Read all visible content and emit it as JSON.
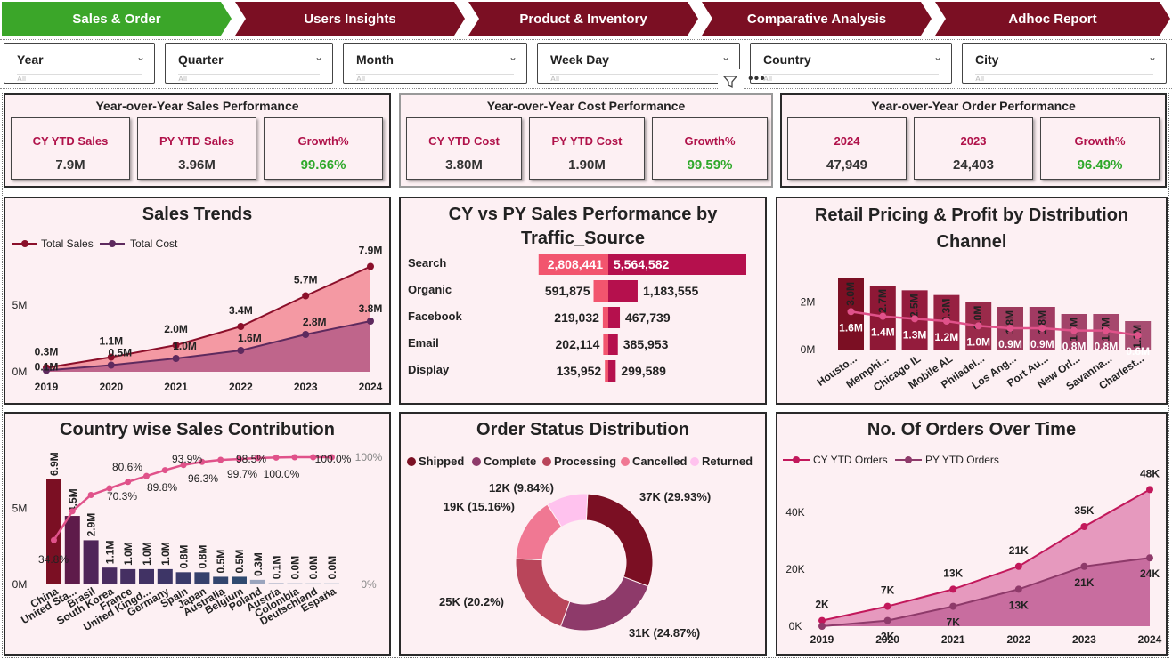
{
  "tabs": [
    {
      "label": "Sales & Order",
      "active": true
    },
    {
      "label": "Users Insights",
      "active": false
    },
    {
      "label": "Product & Inventory",
      "active": false
    },
    {
      "label": "Comparative Analysis",
      "active": false
    },
    {
      "label": "Adhoc Report",
      "active": false
    }
  ],
  "filters": [
    {
      "label": "Year",
      "value": "All"
    },
    {
      "label": "Quarter",
      "value": "All"
    },
    {
      "label": "Month",
      "value": "All"
    },
    {
      "label": "Week Day",
      "value": "All"
    },
    {
      "label": "Country",
      "value": "All"
    },
    {
      "label": "City",
      "value": "All"
    }
  ],
  "colors": {
    "accent": "#7b0f23",
    "active_tab": "#3ba629",
    "panel_bg": "#fdf0f3",
    "growth_green": "#2ea82a",
    "label_pink": "#b0124a"
  },
  "kpi": {
    "sales": {
      "title": "Year-over-Year Sales Performance",
      "cards": [
        {
          "label": "CY YTD Sales",
          "value": "7.9M"
        },
        {
          "label": "PY YTD Sales",
          "value": "3.96M"
        },
        {
          "label": "Growth%",
          "value": "99.66%"
        }
      ]
    },
    "cost": {
      "title": "Year-over-Year Cost Performance",
      "cards": [
        {
          "label": "CY YTD Cost",
          "value": "3.80M"
        },
        {
          "label": "PY YTD Cost",
          "value": "1.90M"
        },
        {
          "label": "Growth%",
          "value": "99.59%"
        }
      ]
    },
    "orders": {
      "title": "Year-over-Year Order Performance",
      "cards": [
        {
          "label": "2024",
          "value": "47,949"
        },
        {
          "label": "2023",
          "value": "24,403"
        },
        {
          "label": "Growth%",
          "value": "96.49%"
        }
      ]
    }
  },
  "sales_trends": {
    "title": "Sales Trends",
    "legend": [
      "Total Sales",
      "Total Cost"
    ],
    "y_ticks": [
      "0M",
      "5M"
    ],
    "chart_data": {
      "type": "area",
      "x": [
        "2019",
        "2020",
        "2021",
        "2022",
        "2023",
        "2024"
      ],
      "series": [
        {
          "name": "Total Sales",
          "values": [
            0.3,
            1.1,
            2.0,
            3.4,
            5.7,
            7.9
          ],
          "labels": [
            "0.3M",
            "1.1M",
            "2.0M",
            "3.4M",
            "5.7M",
            "7.9M"
          ],
          "color": "#8b0f2a"
        },
        {
          "name": "Total Cost",
          "values": [
            0.1,
            0.5,
            1.0,
            1.6,
            2.8,
            3.8
          ],
          "labels": [
            "0.1M",
            "0.5M",
            "1.0M",
            "1.6M",
            "2.8M",
            "3.8M"
          ],
          "color": "#5e2a5e"
        }
      ],
      "ylim": [
        0,
        8
      ]
    }
  },
  "traffic": {
    "title": "CY vs PY Sales Performance by Traffic_Source",
    "chart_data": {
      "type": "bar",
      "categories": [
        "Search",
        "Organic",
        "Facebook",
        "Email",
        "Display"
      ],
      "series": [
        {
          "name": "PY",
          "values": [
            2808441,
            591875,
            219032,
            202114,
            135952
          ],
          "labels": [
            "2,808,441",
            "591,875",
            "219,032",
            "202,114",
            "135,952"
          ],
          "color": "#f2556e"
        },
        {
          "name": "CY",
          "values": [
            5564582,
            1183555,
            467739,
            385953,
            299589
          ],
          "labels": [
            "5,564,582",
            "1,183,555",
            "467,739",
            "385,953",
            "299,589"
          ],
          "color": "#b5104d"
        }
      ]
    }
  },
  "retail": {
    "title": "Retail Pricing & Profit by Distribution Channel",
    "y_ticks": [
      "0M",
      "2M"
    ],
    "chart_data": {
      "type": "bar",
      "categories": [
        "Housto...",
        "Memphi...",
        "Chicago IL",
        "Mobile AL",
        "Philadel...",
        "Los Ang...",
        "Port Au...",
        "New Orl...",
        "Savanna...",
        "Charlest..."
      ],
      "series": [
        {
          "name": "Retail Pricing",
          "values": [
            3.0,
            2.7,
            2.5,
            2.3,
            2.0,
            1.8,
            1.8,
            1.5,
            1.5,
            1.2
          ],
          "labels": [
            "3.0M",
            "2.7M",
            "2.5M",
            "2.3M",
            "2.0M",
            "1.8M",
            "1.8M",
            "1.5M",
            "1.5M",
            "1.2M"
          ]
        },
        {
          "name": "Profit",
          "values": [
            1.6,
            1.4,
            1.3,
            1.2,
            1.0,
            0.9,
            0.9,
            0.8,
            0.8,
            0.6
          ],
          "labels": [
            "1.6M",
            "1.4M",
            "1.3M",
            "1.2M",
            "1.0M",
            "0.9M",
            "0.9M",
            "0.8M",
            "0.8M",
            "0.6M"
          ]
        }
      ],
      "ylim": [
        0,
        3.2
      ]
    }
  },
  "country": {
    "title": "Country wise Sales Contribution",
    "y_ticks": [
      "0M",
      "5M"
    ],
    "y2_ticks": [
      "0%",
      "100%"
    ],
    "chart_data": {
      "type": "bar",
      "categories": [
        "China",
        "United Sta...",
        "Brasil",
        "South Korea",
        "France",
        "United Kingd...",
        "Germany",
        "Spain",
        "Japan",
        "Australia",
        "Belgium",
        "Poland",
        "Austria",
        "Colombia",
        "Deutschland",
        "España"
      ],
      "series": [
        {
          "name": "Sales",
          "values": [
            6.9,
            4.5,
            2.9,
            1.1,
            1.0,
            1.0,
            1.0,
            0.8,
            0.8,
            0.5,
            0.5,
            0.3,
            0.1,
            0.0,
            0.0,
            0.0
          ],
          "labels": [
            "6.9M",
            "4.5M",
            "2.9M",
            "1.1M",
            "1.0M",
            "1.0M",
            "1.0M",
            "0.8M",
            "0.8M",
            "0.5M",
            "0.5M",
            "0.3M",
            "0.1M",
            "0.0M",
            "0.0M",
            "0.0M"
          ]
        },
        {
          "name": "Cumulative %",
          "values": [
            34.8,
            57.5,
            70.3,
            75.5,
            80.6,
            85.2,
            89.8,
            93.9,
            96.3,
            97.9,
            98.5,
            99.4,
            99.7,
            100.0,
            100.0,
            100.0
          ],
          "labels": [
            "34.8%",
            "",
            "70.3%",
            "",
            "80.6%",
            "",
            "89.8%",
            "93.9%",
            "96.3%",
            "",
            "98.5%",
            "",
            "99.7%",
            "100.0%",
            "",
            "100.0%"
          ]
        }
      ],
      "ylim": [
        0,
        7.5
      ]
    }
  },
  "order_status": {
    "title": "Order Status Distribution",
    "chart_data": {
      "type": "pie",
      "categories": [
        "Shipped",
        "Complete",
        "Processing",
        "Cancelled",
        "Returned"
      ],
      "values": [
        29.93,
        24.87,
        20.2,
        15.16,
        9.84
      ],
      "labels": [
        "37K (29.93%)",
        "31K (24.87%)",
        "25K (20.2%)",
        "19K (15.16%)",
        "12K (9.84%)"
      ],
      "colors": [
        "#7b0f23",
        "#8e3a6a",
        "#b9455a",
        "#f07893",
        "#ffc2ee"
      ]
    }
  },
  "orders_time": {
    "title": "No. Of Orders Over Time",
    "legend": [
      "CY YTD Orders",
      "PY YTD Orders"
    ],
    "y_ticks": [
      "0K",
      "20K",
      "40K"
    ],
    "chart_data": {
      "type": "area",
      "x": [
        "2019",
        "2020",
        "2021",
        "2022",
        "2023",
        "2024"
      ],
      "series": [
        {
          "name": "CY YTD Orders",
          "values": [
            2,
            7,
            13,
            21,
            35,
            48
          ],
          "labels": [
            "2K",
            "7K",
            "13K",
            "21K",
            "35K",
            "48K"
          ],
          "color": "#c2185b"
        },
        {
          "name": "PY YTD Orders",
          "values": [
            0,
            2,
            7,
            13,
            21,
            24
          ],
          "labels": [
            "",
            "2K",
            "7K",
            "13K",
            "21K",
            "24K"
          ],
          "color": "#8e3a6a"
        }
      ],
      "ylim": [
        0,
        50
      ]
    }
  }
}
